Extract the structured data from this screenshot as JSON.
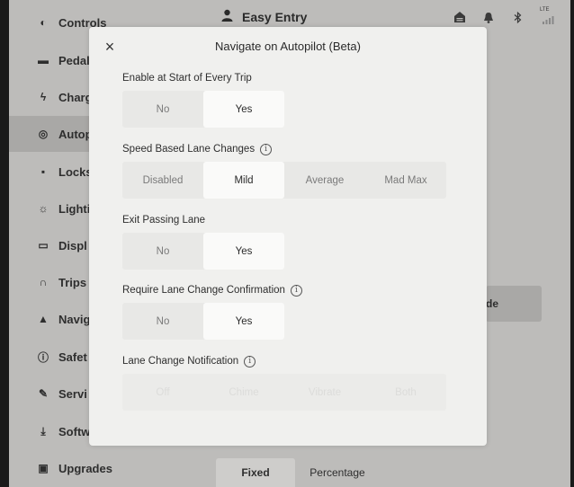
{
  "sidebar": {
    "items": [
      {
        "label": "Controls",
        "icon": "toggle-icon",
        "glyph": "◐"
      },
      {
        "label": "Pedal",
        "icon": "car-icon",
        "glyph": "▬"
      },
      {
        "label": "Charg",
        "icon": "bolt-icon",
        "glyph": "ϟ"
      },
      {
        "label": "Autop",
        "icon": "steering-wheel-icon",
        "glyph": "◎"
      },
      {
        "label": "Locks",
        "icon": "lock-icon",
        "glyph": "▪"
      },
      {
        "label": "Lighti",
        "icon": "sun-icon",
        "glyph": "☼"
      },
      {
        "label": "Displ",
        "icon": "display-icon",
        "glyph": "▭"
      },
      {
        "label": "Trips",
        "icon": "trips-icon",
        "glyph": "∩"
      },
      {
        "label": "Navig",
        "icon": "navigation-icon",
        "glyph": "▲"
      },
      {
        "label": "Safet",
        "icon": "safety-icon",
        "glyph": "ⓘ"
      },
      {
        "label": "Servi",
        "icon": "wrench-icon",
        "glyph": "✎"
      },
      {
        "label": "Softw",
        "icon": "download-icon",
        "glyph": "⤓"
      },
      {
        "label": "Upgrades",
        "icon": "bag-icon",
        "glyph": "▣"
      }
    ]
  },
  "topbar": {
    "profile_name": "Easy Entry",
    "network_label": "LTE"
  },
  "background": {
    "button_label": "de",
    "fixed_label": "Fixed",
    "percentage_label": "Percentage"
  },
  "modal": {
    "title": "Navigate on Autopilot (Beta)",
    "sections": [
      {
        "label": "Enable at Start of Every Trip",
        "options": [
          "No",
          "Yes"
        ],
        "selected": "Yes",
        "info": false,
        "disabled": false
      },
      {
        "label": "Speed Based Lane Changes",
        "options": [
          "Disabled",
          "Mild",
          "Average",
          "Mad Max"
        ],
        "selected": "Mild",
        "info": true,
        "disabled": false
      },
      {
        "label": "Exit Passing Lane",
        "options": [
          "No",
          "Yes"
        ],
        "selected": "Yes",
        "info": false,
        "disabled": false
      },
      {
        "label": "Require Lane Change Confirmation",
        "options": [
          "No",
          "Yes"
        ],
        "selected": "Yes",
        "info": true,
        "disabled": false
      },
      {
        "label": "Lane Change Notification",
        "options": [
          "Off",
          "Chime",
          "Vibrate",
          "Both"
        ],
        "selected": "",
        "info": true,
        "disabled": true
      }
    ]
  }
}
